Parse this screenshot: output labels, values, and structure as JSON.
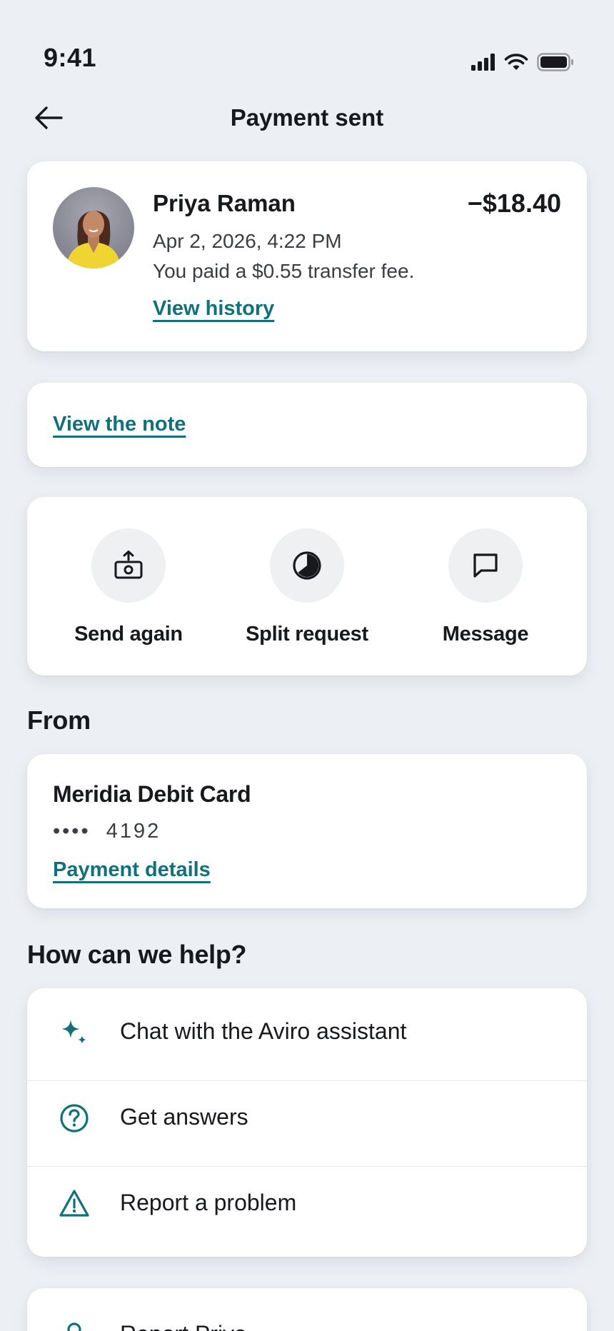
{
  "status_bar": {
    "time": "9:41",
    "icons": [
      "cellular-signal-icon",
      "wifi-icon",
      "battery-icon"
    ]
  },
  "header": {
    "back_icon": "arrow-left-icon",
    "title": "Payment sent"
  },
  "payment": {
    "name": "Priya Raman",
    "amount": "−$18.40",
    "date": "Apr 2, 2026, 4:22 PM",
    "fee_text": "You paid a $0.55 transfer fee.",
    "history_link": "View history"
  },
  "note": {
    "link": "View the note"
  },
  "actions": [
    {
      "label": "Send again",
      "icon": "send-money-icon"
    },
    {
      "label": "Split request",
      "icon": "pie-chart-icon"
    },
    {
      "label": "Message",
      "icon": "chat-bubble-icon"
    }
  ],
  "from": {
    "section_title": "From",
    "card_name": "Meridia Debit Card",
    "card_dots": "••••",
    "card_last4": "4192",
    "details_link": "Payment details"
  },
  "help": {
    "section_title": "How can we help?",
    "items": [
      {
        "label": "Chat with the Aviro assistant",
        "icon": "sparkle-icon"
      },
      {
        "label": "Get answers",
        "icon": "question-circle-icon"
      },
      {
        "label": "Report a problem",
        "icon": "warning-triangle-icon"
      }
    ]
  },
  "bottom": {
    "label": "Report Priya",
    "icon": "person-icon"
  },
  "colors": {
    "background": "#eceff3",
    "card": "#ffffff",
    "accent": "#11707a",
    "text": "#17191c"
  }
}
